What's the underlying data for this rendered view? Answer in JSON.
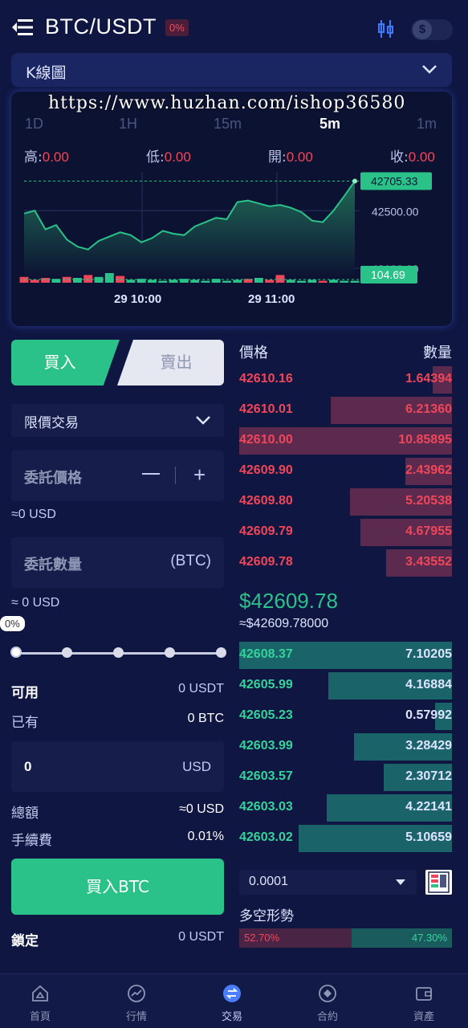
{
  "header": {
    "pair": "BTC/USDT",
    "change_badge": "0%",
    "toggle_symbol": "$"
  },
  "kline_selector": {
    "label": "K線圖"
  },
  "watermark": "https://www.huzhan.com/ishop36580",
  "timeframes": [
    "1D",
    "1H",
    "15m",
    "5m",
    "1m"
  ],
  "active_timeframe": "5m",
  "ohlc": {
    "high_label": "高:",
    "high": "0.00",
    "low_label": "低:",
    "low": "0.00",
    "open_label": "開:",
    "open": "0.00",
    "close_label": "收:",
    "close": "0.00"
  },
  "chart_data": {
    "type": "area",
    "x_tick_labels": [
      "29 10:00",
      "29 11:00"
    ],
    "y_tick_labels": [
      "42500.00",
      "42100.00"
    ],
    "last_price_tag": "42705.33",
    "volume_tag": "104.69",
    "values": [
      42480,
      42500,
      42370,
      42400,
      42300,
      42250,
      42230,
      42290,
      42320,
      42350,
      42330,
      42280,
      42310,
      42360,
      42340,
      42330,
      42390,
      42420,
      42450,
      42440,
      42560,
      42570,
      42550,
      42530,
      42540,
      42520,
      42490,
      42430,
      42420,
      42500,
      42600,
      42705
    ],
    "volumes": [
      6,
      3,
      5,
      4,
      6,
      5,
      8,
      6,
      10,
      7,
      3,
      4,
      3,
      2,
      3,
      4,
      3,
      2,
      4,
      2,
      3,
      4,
      5,
      3,
      8,
      3,
      2,
      3,
      2,
      3,
      2,
      2
    ],
    "volume_colors": [
      "red",
      "red",
      "red",
      "green",
      "red",
      "green",
      "red",
      "green",
      "green",
      "red",
      "green",
      "green",
      "green",
      "green",
      "green",
      "green",
      "green",
      "green",
      "green",
      "green",
      "green",
      "red",
      "green",
      "red",
      "red",
      "green",
      "green",
      "green",
      "red",
      "green",
      "green",
      "green"
    ],
    "ylim": [
      42000,
      42780
    ],
    "colors": {
      "line": "#2bc28a",
      "area_top": "#1f6a55",
      "area_bottom": "#0c1232",
      "up": "#2bc28a",
      "down": "#f0465a"
    }
  },
  "trade": {
    "buy_tab": "買入",
    "sell_tab": "賣出",
    "order_type": "限價交易",
    "price_label": "委託價格",
    "minus": "—",
    "plus": "+",
    "price_usd_note": "≈0 USD",
    "qty_label": "委託數量",
    "qty_unit": "(BTC)",
    "qty_usd_note": "≈ 0 USD",
    "slider_pct": "0%",
    "available_label": "可用",
    "available_value": "0 USDT",
    "owned_label": "已有",
    "owned_value": "0 BTC",
    "amount_value": "0",
    "amount_unit": "USD",
    "total_label": "總額",
    "total_value": "≈0 USD",
    "fee_label": "手續費",
    "fee_value": "0.01%",
    "buy_button": "買入BTC",
    "locked_label": "鎖定",
    "locked_value": "0 USDT"
  },
  "orderbook": {
    "price_header": "價格",
    "qty_header": "數量",
    "asks": [
      {
        "price": "42610.16",
        "qty": "1.64394",
        "depth": 0.09
      },
      {
        "price": "42610.01",
        "qty": "6.21360",
        "depth": 0.57
      },
      {
        "price": "42610.00",
        "qty": "10.85895",
        "depth": 1.0
      },
      {
        "price": "42609.90",
        "qty": "2.43962",
        "depth": 0.22
      },
      {
        "price": "42609.80",
        "qty": "5.20538",
        "depth": 0.48
      },
      {
        "price": "42609.79",
        "qty": "4.67955",
        "depth": 0.43
      },
      {
        "price": "42609.78",
        "qty": "3.43552",
        "depth": 0.31
      }
    ],
    "last_price": "$42609.78",
    "last_price_sub": "≈$42609.78000",
    "bids": [
      {
        "price": "42608.37",
        "qty": "7.10205",
        "depth": 1.0
      },
      {
        "price": "42605.99",
        "qty": "4.16884",
        "depth": 0.58
      },
      {
        "price": "42605.23",
        "qty": "0.57992",
        "depth": 0.08
      },
      {
        "price": "42603.99",
        "qty": "3.28429",
        "depth": 0.46
      },
      {
        "price": "42603.57",
        "qty": "2.30712",
        "depth": 0.32
      },
      {
        "price": "42603.03",
        "qty": "4.22141",
        "depth": 0.59
      },
      {
        "price": "42603.02",
        "qty": "5.10659",
        "depth": 0.72
      }
    ],
    "depth_select": "0.0001",
    "long_short_label": "多空形勢",
    "long_pct": "52.70%",
    "short_pct": "47.30%",
    "long_ratio": 0.527
  },
  "nav": [
    {
      "label": "首頁",
      "icon": "home-icon"
    },
    {
      "label": "行情",
      "icon": "market-icon"
    },
    {
      "label": "交易",
      "icon": "trade-icon",
      "active": true
    },
    {
      "label": "合約",
      "icon": "contract-icon"
    },
    {
      "label": "資產",
      "icon": "wallet-icon"
    }
  ]
}
